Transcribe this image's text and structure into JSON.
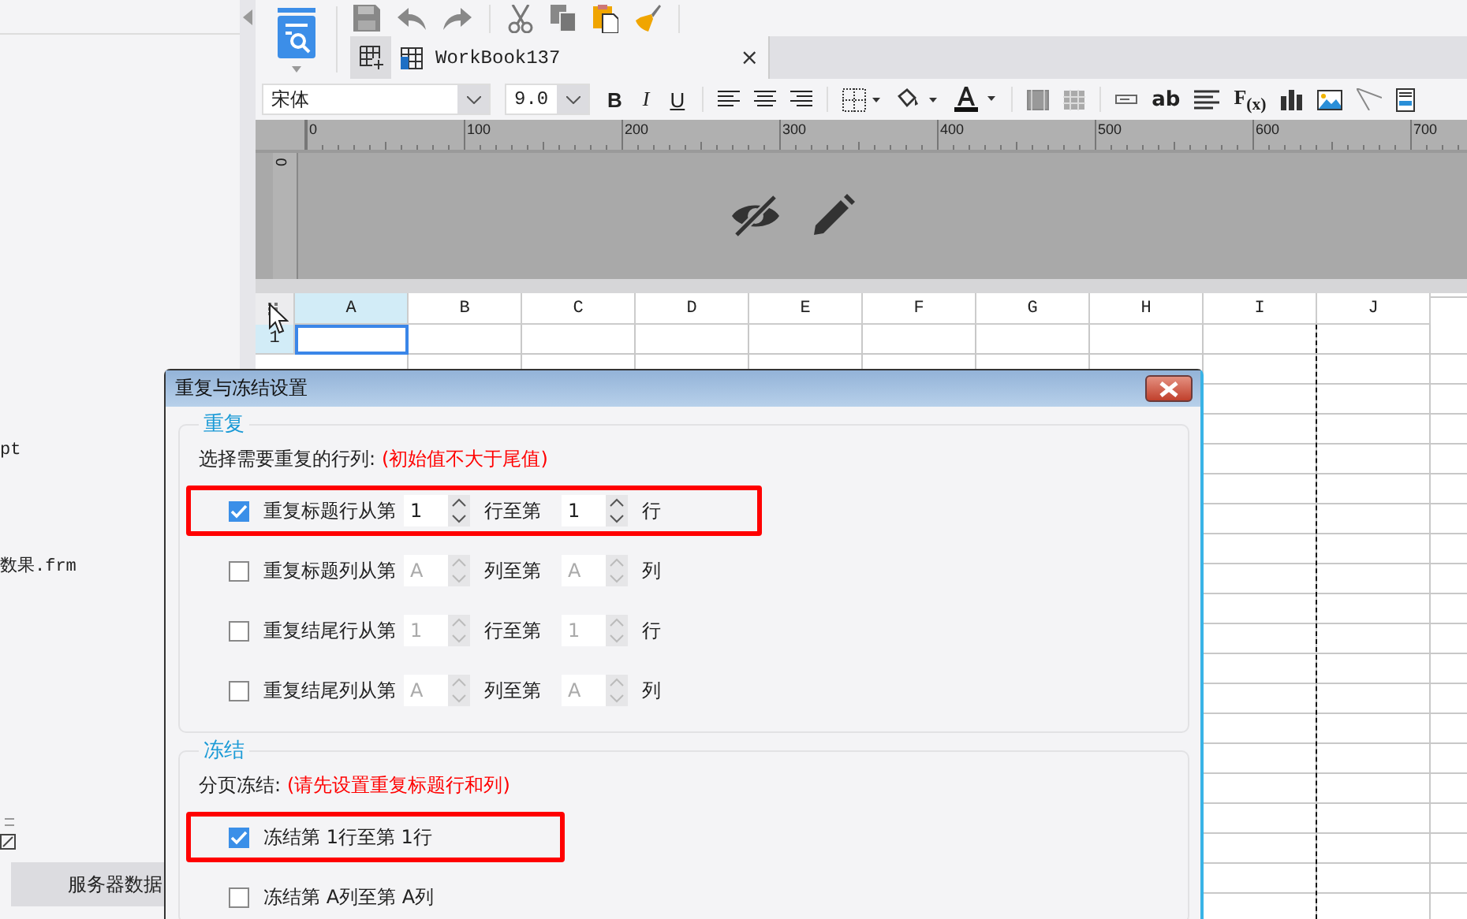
{
  "left_panel": {
    "texts": [
      "pt",
      "数果.frm"
    ],
    "server_tab": "服务器数据"
  },
  "tabs": [
    {
      "label": "WorkBook137",
      "selected": true,
      "close": "×"
    }
  ],
  "format_bar": {
    "font": "宋体",
    "size": "9.0",
    "bold": "B",
    "italic": "I",
    "underline": "U",
    "text_tool": "ab",
    "formula_tool": "F$_{(x)}$"
  },
  "ruler": {
    "labels": [
      "0",
      "100",
      "200",
      "300",
      "400",
      "500",
      "600",
      "700"
    ],
    "side_label": "0"
  },
  "sheet": {
    "columns": [
      {
        "label": "A",
        "selected": true
      },
      {
        "label": "B",
        "selected": false
      },
      {
        "label": "C",
        "selected": false
      },
      {
        "label": "D",
        "selected": false
      },
      {
        "label": "E",
        "selected": false
      },
      {
        "label": "F",
        "selected": false
      },
      {
        "label": "G",
        "selected": false
      },
      {
        "label": "H",
        "selected": false
      },
      {
        "label": "I",
        "selected": false
      },
      {
        "label": "J",
        "selected": false
      }
    ],
    "rows": [
      {
        "label": "1",
        "selected": true
      }
    ]
  },
  "dialog": {
    "title": "重复与冻结设置",
    "repeat": {
      "legend": "重复",
      "hint": "选择需要重复的行列:",
      "note": "(初始值不大于尾值)",
      "rows": [
        {
          "checked": true,
          "highlighted": true,
          "label": "重复标题行从第",
          "from": {
            "value": "1",
            "disabled": false
          },
          "mid": "行至第",
          "to": {
            "value": "1",
            "disabled": false
          },
          "unit": "行"
        },
        {
          "checked": false,
          "highlighted": false,
          "label": "重复标题列从第",
          "from": {
            "value": "A",
            "disabled": true
          },
          "mid": "列至第",
          "to": {
            "value": "A",
            "disabled": true
          },
          "unit": "列"
        },
        {
          "checked": false,
          "highlighted": false,
          "label": "重复结尾行从第",
          "from": {
            "value": "1",
            "disabled": true
          },
          "mid": "行至第",
          "to": {
            "value": "1",
            "disabled": true
          },
          "unit": "行"
        },
        {
          "checked": false,
          "highlighted": false,
          "label": "重复结尾列从第",
          "from": {
            "value": "A",
            "disabled": true
          },
          "mid": "列至第",
          "to": {
            "value": "A",
            "disabled": true
          },
          "unit": "列"
        }
      ]
    },
    "freeze": {
      "legend": "冻结",
      "hint": "分页冻结:",
      "note": "(请先设置重复标题行和列)",
      "rows": [
        {
          "checked": true,
          "highlighted": true,
          "label": "冻结第 1行至第 1行"
        },
        {
          "checked": false,
          "highlighted": false,
          "label": "冻结第 A列至第 A列"
        }
      ]
    }
  }
}
